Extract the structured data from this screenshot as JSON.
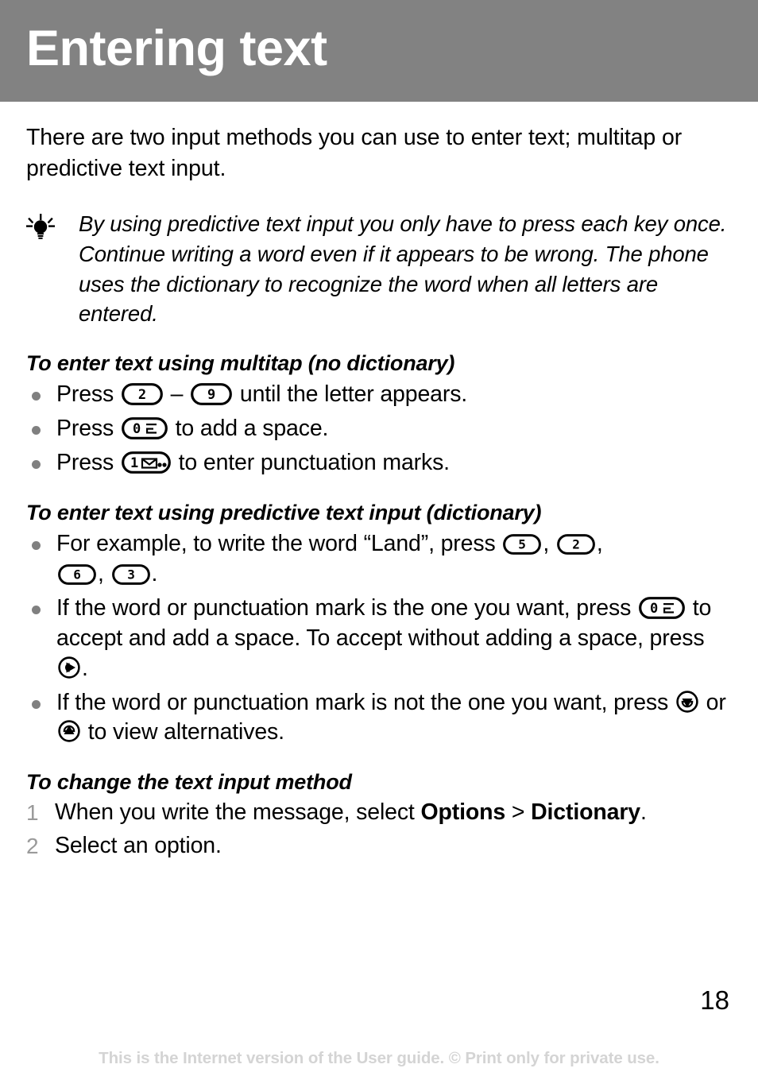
{
  "header": {
    "title": "Entering text",
    "background_color": "#828282",
    "text_color": "#ffffff"
  },
  "intro": {
    "paragraph": "There are two input methods you can use to enter text; multitap or predictive text input."
  },
  "tip": {
    "icon": "lightbulb-icon",
    "text": "By using predictive text input you only have to press each key once. Continue writing a word even if it appears to be wrong. The phone uses the dictionary to recognize the word when all letters are entered."
  },
  "sections": [
    {
      "heading": "To enter text using multitap (no dictionary)",
      "bullets": [
        {
          "pre": "Press ",
          "key1": "2",
          "mid": " – ",
          "key2": "9",
          "post": " until the letter appears."
        },
        {
          "pre": "Press ",
          "key1": "0",
          "post": " to add a space."
        },
        {
          "pre": "Press ",
          "key1": "1",
          "post": " to enter punctuation marks."
        }
      ]
    },
    {
      "heading": "To enter text using predictive text input (dictionary)",
      "bullets": [
        {
          "pre": "For example, to write the word “Land”, press ",
          "keys": [
            "5",
            "2",
            "6",
            "3"
          ],
          "post": "."
        },
        {
          "pre": "If the word or punctuation mark is the one you want, press ",
          "mid": " to accept and add a space. To accept without adding a space, press ",
          "post": "."
        },
        {
          "pre": "If the word or punctuation mark is not the one you want, press ",
          "mid": " or ",
          "post": " to view alternatives."
        }
      ]
    },
    {
      "heading": "To change the text input method",
      "steps": [
        {
          "num": "1",
          "pre": "When you write the message, select ",
          "bold1": "Options",
          "mid": " > ",
          "bold2": "Dictionary",
          "post": "."
        },
        {
          "num": "2",
          "pre": "Select an option."
        }
      ]
    }
  ],
  "keys": {
    "k0_label": "0",
    "k1_label": "1",
    "k2_label": "2",
    "k3_label": "3",
    "k5_label": "5",
    "k6_label": "6",
    "k9_label": "9",
    "space_symbol": "space-symbol-icon",
    "voicemail_symbol": "envelope-voicemail-icon",
    "nav_right": "nav-right-icon",
    "nav_up": "nav-up-icon",
    "nav_down": "nav-down-icon"
  },
  "footer": {
    "page_number": "18",
    "note": "This is the Internet version of the User guide. © Print only for private use.",
    "note_color": "#d4d4d4"
  }
}
